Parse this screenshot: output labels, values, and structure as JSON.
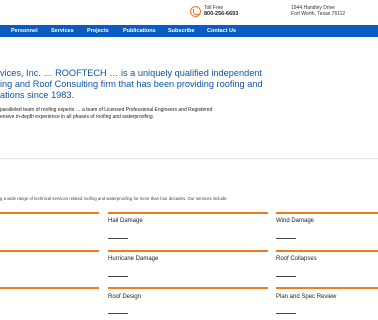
{
  "header": {
    "phone_label": "Toll Free",
    "phone_number": "800-256-6693",
    "address_line1": "1944 Handley Drive",
    "address_line2": "Fort Worth, Texas 76112"
  },
  "nav": {
    "items": [
      "Personnel",
      "Services",
      "Projects",
      "Publications",
      "Subscribe",
      "Contact Us"
    ]
  },
  "hero": {
    "lines": [
      "vices, Inc. … ROOFTECH … is a uniquely qualified independent",
      "ing and Roof Consulting firm that has been providing roofing and",
      "ations since 1983."
    ]
  },
  "intro": {
    "lines": [
      "paralleled team of roofing experts … a team of Licensed Professional Engineers and Registered",
      "ensive in-depth experience in all phases of roofing and waterproofing."
    ]
  },
  "services": {
    "intro": "g a wide range of technical services related roofing and waterproofing for more than four decades. Our services include:",
    "items": [
      "Hail Damage",
      "Wind Damage",
      "Hurricane Damage",
      "Roof Collapses",
      "Roof Design",
      "Plan and Spec Review"
    ]
  },
  "colors": {
    "nav_bg": "#0a5bc4",
    "accent": "#f07b1e",
    "hero_text": "#1253a8"
  },
  "icons": {
    "phone": "phone-icon"
  }
}
